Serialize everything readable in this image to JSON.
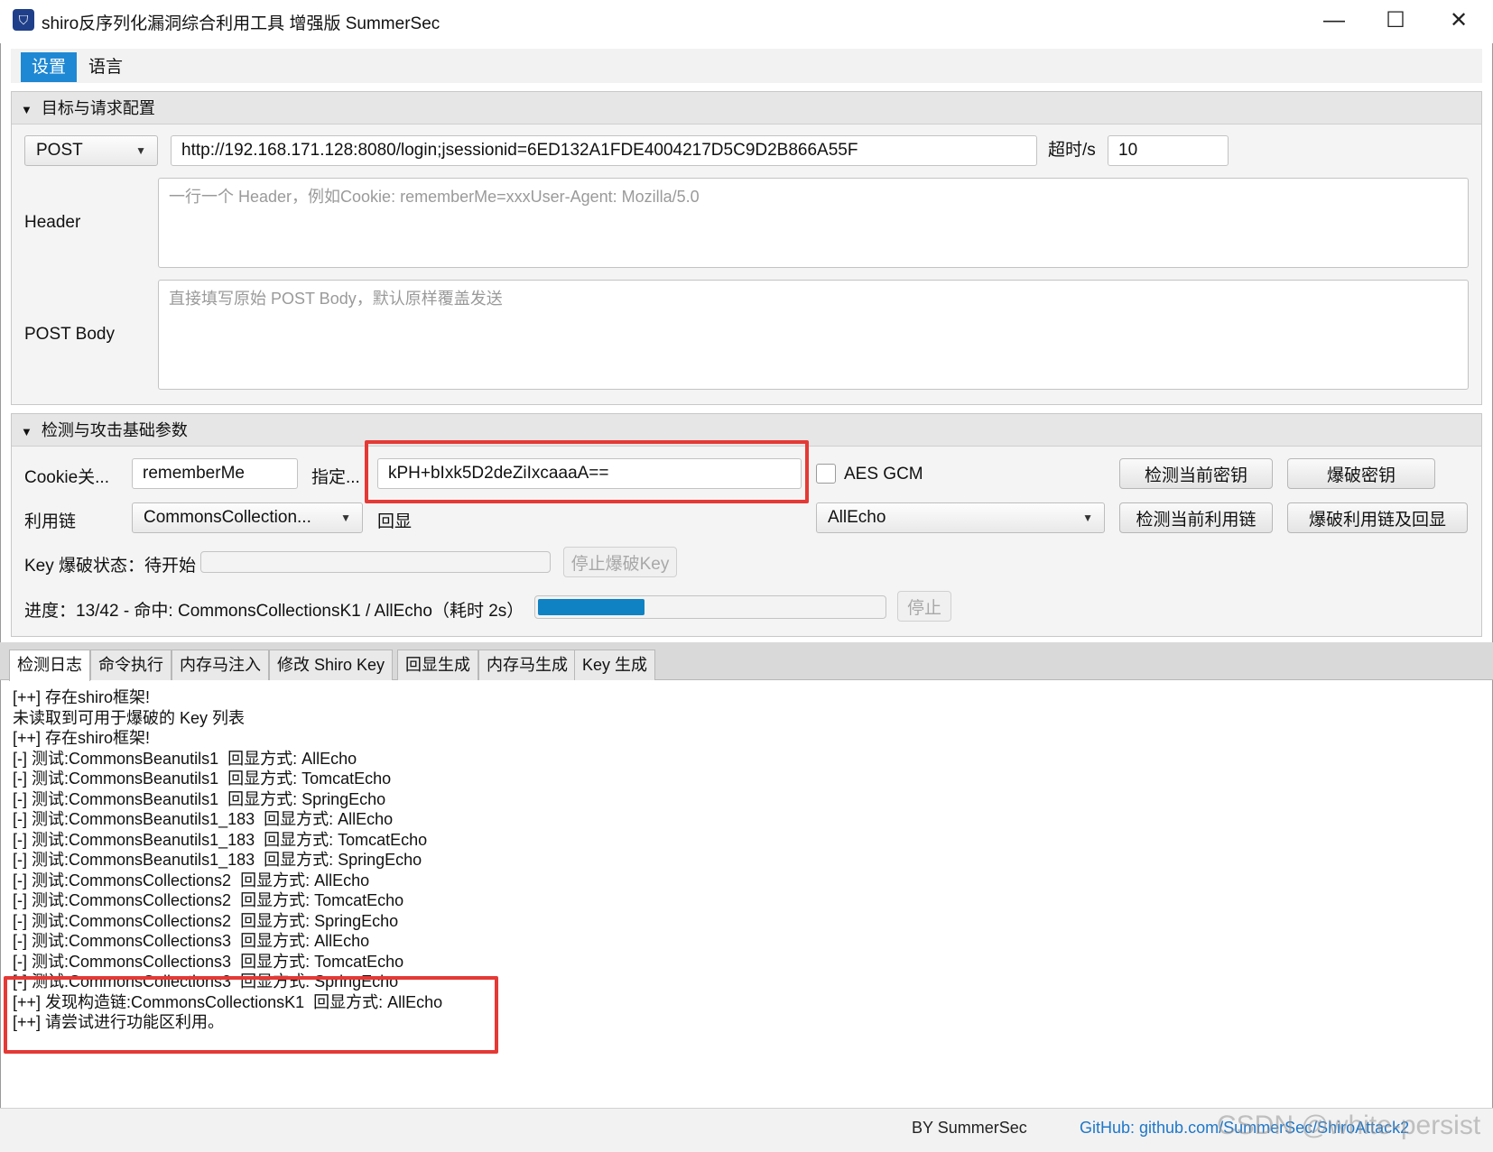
{
  "window": {
    "title": "shiro反序列化漏洞综合利用工具 增强版 SummerSec",
    "icon": "app-shield-icon",
    "controls": {
      "minimize": "—",
      "maximize": "☐",
      "close": "✕"
    }
  },
  "menu": {
    "items": [
      "设置",
      "语言"
    ],
    "active": "设置"
  },
  "target_section": {
    "title": "目标与请求配置",
    "method": "POST",
    "url": "http://192.168.171.128:8080/login;jsessionid=6ED132A1FDE4004217D5C9D2B866A55F",
    "timeout_label": "超时/s",
    "timeout_value": "10",
    "header_label": "Header",
    "header_placeholder": "一行一个 Header，例如Cookie: rememberMe=xxxUser-Agent: Mozilla/5.0",
    "body_label": "POST Body",
    "body_placeholder": "直接填写原始 POST Body，默认原样覆盖发送"
  },
  "attack_section": {
    "title": "检测与攻击基础参数",
    "cookie_label": "Cookie关...",
    "cookie_value": "rememberMe",
    "key_label": "指定...",
    "key_value": "kPH+bIxk5D2deZiIxcaaaA==",
    "aes_gcm_label": "AES GCM",
    "aes_gcm_checked": false,
    "btn_check_key": "检测当前密钥",
    "btn_brute_key": "爆破密钥",
    "chain_label": "利用链",
    "chain_value": "CommonsCollection...",
    "echo_label": "回显",
    "echo_value": "AllEcho",
    "btn_check_chain": "检测当前利用链",
    "btn_brute_chain": "爆破利用链及回显",
    "key_status_label": "Key 爆破状态：待开始",
    "btn_stop_key": "停止爆破Key",
    "progress_label": "进度：13/42 - 命中: CommonsCollectionsK1 / AllEcho（耗时 2s）",
    "progress_fraction": 0.31,
    "btn_stop": "停止"
  },
  "tabs": [
    "检测日志",
    "命令执行",
    "内存马注入",
    "修改 Shiro Key",
    "回显生成",
    "内存马生成",
    "Key 生成"
  ],
  "active_tab": "检测日志",
  "log_lines": [
    "[++] 存在shiro框架!",
    "未读取到可用于爆破的 Key 列表",
    "[++] 存在shiro框架!",
    "[-] 测试:CommonsBeanutils1  回显方式: AllEcho",
    "[-] 测试:CommonsBeanutils1  回显方式: TomcatEcho",
    "[-] 测试:CommonsBeanutils1  回显方式: SpringEcho",
    "[-] 测试:CommonsBeanutils1_183  回显方式: AllEcho",
    "[-] 测试:CommonsBeanutils1_183  回显方式: TomcatEcho",
    "[-] 测试:CommonsBeanutils1_183  回显方式: SpringEcho",
    "[-] 测试:CommonsCollections2  回显方式: AllEcho",
    "[-] 测试:CommonsCollections2  回显方式: TomcatEcho",
    "[-] 测试:CommonsCollections2  回显方式: SpringEcho",
    "[-] 测试:CommonsCollections3  回显方式: AllEcho",
    "[-] 测试:CommonsCollections3  回显方式: TomcatEcho",
    "[-] 测试:CommonsCollections3  回显方式: SpringEcho",
    "[++] 发现构造链:CommonsCollectionsK1  回显方式: AllEcho",
    "[++] 请尝试进行功能区利用。"
  ],
  "footer": {
    "by": "BY SummerSec",
    "github": "GitHub: github.com/SummerSec/ShiroAttack2",
    "watermark": "CSDN @white-persist"
  },
  "colors": {
    "accent": "#1e88d4",
    "progress": "#0f82c4",
    "highlight": "#e53935",
    "link": "#1e77c9"
  }
}
